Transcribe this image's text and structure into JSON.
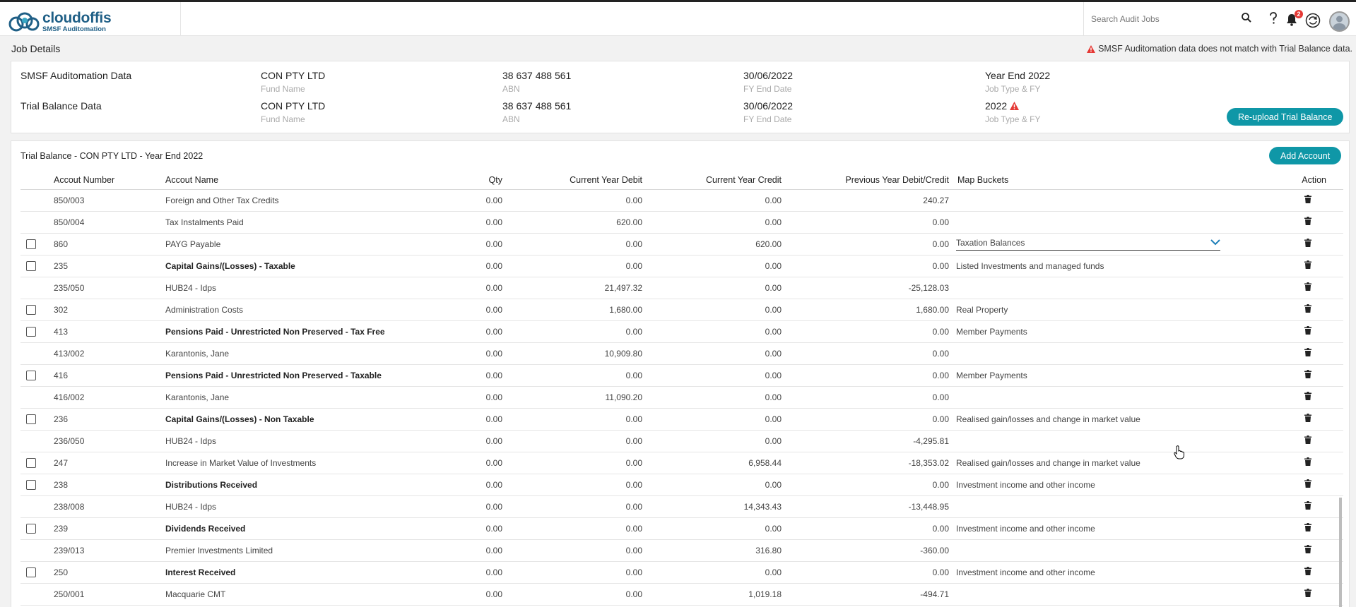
{
  "header": {
    "logo_main": "cloudoffis",
    "logo_sub": "SMSF Auditomation",
    "search_placeholder": "Search Audit Jobs",
    "notif_count": "2"
  },
  "job": {
    "title": "Job Details",
    "mismatch_msg": "SMSF Auditomation data does not match with Trial Balance data.",
    "rows": [
      {
        "label": "SMSF Auditomation Data",
        "fund_name": "CON PTY LTD",
        "fund_name_label": "Fund Name",
        "abn": "38 637 488 561",
        "abn_label": "ABN",
        "fy_end": "30/06/2022",
        "fy_end_label": "FY End Date",
        "job_type": "Year End 2022",
        "job_type_label": "Job Type & FY"
      },
      {
        "label": "Trial Balance Data",
        "fund_name": "CON PTY LTD",
        "fund_name_label": "Fund Name",
        "abn": "38 637 488 561",
        "abn_label": "ABN",
        "fy_end": "30/06/2022",
        "fy_end_label": "FY End Date",
        "job_type": "2022",
        "job_type_label": "Job Type & FY"
      }
    ],
    "reupload_label": "Re-upload Trial Balance"
  },
  "trial_balance": {
    "title": "Trial Balance - CON PTY LTD - Year End 2022",
    "add_account_label": "Add Account",
    "columns": [
      "Accout Number",
      "Accout Name",
      "Qty",
      "Current Year Debit",
      "Current Year Credit",
      "Previous Year Debit/Credit",
      "Map Buckets",
      "Action"
    ],
    "rows": [
      {
        "cb": false,
        "num": "850/003",
        "name": "Foreign and Other Tax Credits",
        "qty": "0.00",
        "debit": "0.00",
        "credit": "0.00",
        "prev": "240.27",
        "map": "",
        "bold": false
      },
      {
        "cb": false,
        "num": "850/004",
        "name": "Tax Instalments Paid",
        "qty": "0.00",
        "debit": "620.00",
        "credit": "0.00",
        "prev": "0.00",
        "map": "",
        "bold": false
      },
      {
        "cb": true,
        "num": "860",
        "name": "PAYG Payable",
        "qty": "0.00",
        "debit": "0.00",
        "credit": "620.00",
        "prev": "0.00",
        "map": "Taxation Balances",
        "bold": false,
        "select": true
      },
      {
        "cb": true,
        "num": "235",
        "name": "Capital Gains/(Losses) - Taxable",
        "qty": "0.00",
        "debit": "0.00",
        "credit": "0.00",
        "prev": "0.00",
        "map": "Listed Investments and managed funds",
        "bold": true
      },
      {
        "cb": false,
        "num": "235/050",
        "name": "HUB24 - Idps",
        "qty": "0.00",
        "debit": "21,497.32",
        "credit": "0.00",
        "prev": "-25,128.03",
        "map": "",
        "bold": false
      },
      {
        "cb": true,
        "num": "302",
        "name": "Administration Costs",
        "qty": "0.00",
        "debit": "1,680.00",
        "credit": "0.00",
        "prev": "1,680.00",
        "map": "Real Property",
        "bold": false
      },
      {
        "cb": true,
        "num": "413",
        "name": "Pensions Paid - Unrestricted Non Preserved - Tax Free",
        "qty": "0.00",
        "debit": "0.00",
        "credit": "0.00",
        "prev": "0.00",
        "map": "Member Payments",
        "bold": true
      },
      {
        "cb": false,
        "num": "413/002",
        "name": "Karantonis, Jane",
        "qty": "0.00",
        "debit": "10,909.80",
        "credit": "0.00",
        "prev": "0.00",
        "map": "",
        "bold": false
      },
      {
        "cb": true,
        "num": "416",
        "name": "Pensions Paid - Unrestricted Non Preserved - Taxable",
        "qty": "0.00",
        "debit": "0.00",
        "credit": "0.00",
        "prev": "0.00",
        "map": "Member Payments",
        "bold": true
      },
      {
        "cb": false,
        "num": "416/002",
        "name": "Karantonis, Jane",
        "qty": "0.00",
        "debit": "11,090.20",
        "credit": "0.00",
        "prev": "0.00",
        "map": "",
        "bold": false
      },
      {
        "cb": true,
        "num": "236",
        "name": "Capital Gains/(Losses) - Non Taxable",
        "qty": "0.00",
        "debit": "0.00",
        "credit": "0.00",
        "prev": "0.00",
        "map": "Realised gain/losses and change in market value",
        "bold": true
      },
      {
        "cb": false,
        "num": "236/050",
        "name": "HUB24 - Idps",
        "qty": "0.00",
        "debit": "0.00",
        "credit": "0.00",
        "prev": "-4,295.81",
        "map": "",
        "bold": false
      },
      {
        "cb": true,
        "num": "247",
        "name": "Increase in Market Value of Investments",
        "qty": "0.00",
        "debit": "0.00",
        "credit": "6,958.44",
        "prev": "-18,353.02",
        "map": "Realised gain/losses and change in market value",
        "bold": false
      },
      {
        "cb": true,
        "num": "238",
        "name": "Distributions Received",
        "qty": "0.00",
        "debit": "0.00",
        "credit": "0.00",
        "prev": "0.00",
        "map": "Investment income and other income",
        "bold": true
      },
      {
        "cb": false,
        "num": "238/008",
        "name": "HUB24 - Idps",
        "qty": "0.00",
        "debit": "0.00",
        "credit": "14,343.43",
        "prev": "-13,448.95",
        "map": "",
        "bold": false
      },
      {
        "cb": true,
        "num": "239",
        "name": "Dividends Received",
        "qty": "0.00",
        "debit": "0.00",
        "credit": "0.00",
        "prev": "0.00",
        "map": "Investment income and other income",
        "bold": true
      },
      {
        "cb": false,
        "num": "239/013",
        "name": "Premier Investments Limited",
        "qty": "0.00",
        "debit": "0.00",
        "credit": "316.80",
        "prev": "-360.00",
        "map": "",
        "bold": false
      },
      {
        "cb": true,
        "num": "250",
        "name": "Interest Received",
        "qty": "0.00",
        "debit": "0.00",
        "credit": "0.00",
        "prev": "0.00",
        "map": "Investment income and other income",
        "bold": true
      },
      {
        "cb": false,
        "num": "250/001",
        "name": "Macquarie CMT",
        "qty": "0.00",
        "debit": "0.00",
        "credit": "1,019.18",
        "prev": "-494.71",
        "map": "",
        "bold": false
      }
    ]
  },
  "colors": {
    "accent": "#0f97a7",
    "warning": "#e53935",
    "brand": "#1f5f86"
  }
}
